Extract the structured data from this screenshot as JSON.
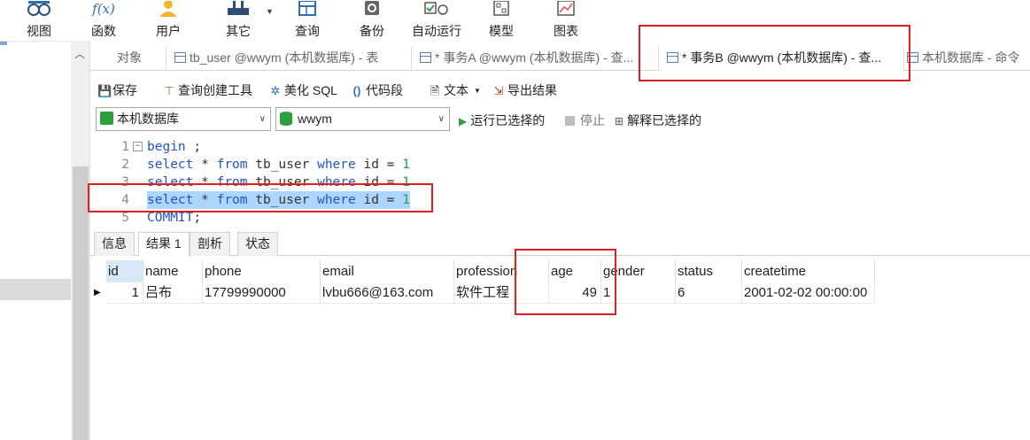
{
  "ribbon": {
    "buttons": [
      {
        "label": "视图",
        "icon": "view-icon"
      },
      {
        "label": "函数",
        "icon": "function-icon"
      },
      {
        "label": "用户",
        "icon": "user-icon"
      },
      {
        "label": "其它",
        "icon": "other-icon"
      },
      {
        "label": "查询",
        "icon": "query-icon"
      },
      {
        "label": "备份",
        "icon": "backup-icon"
      },
      {
        "label": "自动运行",
        "icon": "auto-run-icon"
      },
      {
        "label": "模型",
        "icon": "model-icon"
      },
      {
        "label": "图表",
        "icon": "chart-icon"
      }
    ],
    "function_glyph": "f(x)"
  },
  "tabs": [
    {
      "label": "对象"
    },
    {
      "label": "tb_user @wwym (本机数据库) - 表"
    },
    {
      "label": "* 事务A @wwym (本机数据库) - 查..."
    },
    {
      "label": "* 事务B @wwym (本机数据库) - 查..."
    },
    {
      "label": "本机数据库 - 命令"
    }
  ],
  "toolbar": {
    "save": "保存",
    "query_builder": "查询创建工具",
    "beautify": "美化 SQL",
    "snippet": "代码段",
    "text": "文本",
    "export": "导出结果"
  },
  "connection": {
    "server": "本机数据库",
    "database": "wwym",
    "run_selected": "运行已选择的",
    "stop": "停止",
    "explain_selected": "解释已选择的"
  },
  "editor": {
    "lines": [
      {
        "n": "1",
        "tokens": [
          [
            "kw",
            "begin"
          ],
          [
            "pl",
            " ;"
          ]
        ]
      },
      {
        "n": "2",
        "tokens": [
          [
            "kw",
            "select"
          ],
          [
            "pl",
            " * "
          ],
          [
            "kw",
            "from"
          ],
          [
            "pl",
            " tb_user "
          ],
          [
            "kw",
            "where"
          ],
          [
            "pl",
            " id = "
          ],
          [
            "num",
            "1"
          ]
        ]
      },
      {
        "n": "3",
        "tokens": [
          [
            "kw",
            "select"
          ],
          [
            "pl",
            " * "
          ],
          [
            "kw",
            "from"
          ],
          [
            "pl",
            " tb_user "
          ],
          [
            "kw",
            "where"
          ],
          [
            "pl",
            " id = "
          ],
          [
            "num",
            "1"
          ]
        ]
      },
      {
        "n": "4",
        "tokens": [
          [
            "kw",
            "select"
          ],
          [
            "pl",
            " * "
          ],
          [
            "kw",
            "from"
          ],
          [
            "pl",
            " tb_user "
          ],
          [
            "kw",
            "where"
          ],
          [
            "pl",
            " id = "
          ],
          [
            "num",
            "1"
          ]
        ],
        "selected": true
      },
      {
        "n": "5",
        "tokens": [
          [
            "kw",
            "COMMIT"
          ],
          [
            "pl",
            ";"
          ]
        ]
      }
    ]
  },
  "result_tabs": [
    {
      "label": "信息"
    },
    {
      "label": "结果 1"
    },
    {
      "label": "剖析"
    },
    {
      "label": "状态"
    }
  ],
  "grid": {
    "columns": [
      "id",
      "name",
      "phone",
      "email",
      "profession",
      "age",
      "gender",
      "status",
      "createtime"
    ],
    "rows": [
      [
        "1",
        "吕布",
        "17799990000",
        "lvbu666@163.com",
        "软件工程",
        "49",
        "1",
        "6",
        "2001-02-02 00:00:00"
      ]
    ]
  },
  "colors": {
    "accent": "#2f6db5",
    "keyword": "#1f55c8",
    "number": "#19a24a",
    "selection": "#add6ff",
    "annotation": "#e02020"
  }
}
